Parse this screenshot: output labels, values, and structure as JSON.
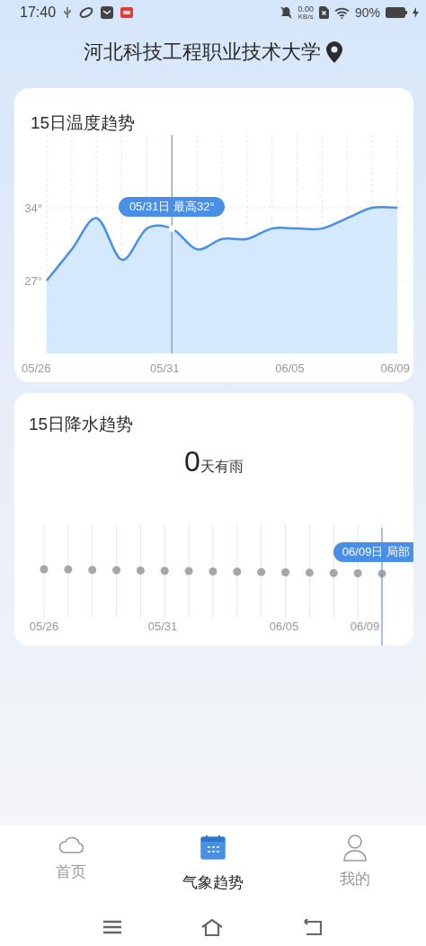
{
  "status_bar": {
    "time": "17:40",
    "net_speed": "0.00",
    "net_unit": "KB/s",
    "battery": "90%"
  },
  "header": {
    "title": "河北科技工程职业技术大学"
  },
  "temperature": {
    "title": "15日温度趋势",
    "chart_data": {
      "type": "area",
      "categories": [
        "05/26",
        null,
        null,
        null,
        null,
        "05/31",
        null,
        null,
        null,
        null,
        "06/05",
        null,
        null,
        null,
        "06/09"
      ],
      "grid": true,
      "series": [
        {
          "color": "#4a90e2",
          "values": [
            27,
            30,
            33,
            29,
            32,
            32,
            30,
            31,
            31,
            32,
            32,
            32,
            33,
            34,
            34
          ]
        }
      ],
      "ylim": [
        20,
        41
      ],
      "yticks": [
        {
          "value": 34,
          "label": "34°"
        },
        {
          "value": 27,
          "label": "27°"
        }
      ],
      "annotations": [
        "05/31日 最高32°"
      ]
    }
  },
  "precipitation": {
    "title": "15日降水趋势",
    "count": "0",
    "count_suffix": "天有雨",
    "tooltip": "06/09日 局部",
    "x_labels": [
      "05/26",
      "05/31",
      "06/05",
      "06/09"
    ]
  },
  "tabs": [
    {
      "label": "首页",
      "selected": false
    },
    {
      "label": "气象趋势",
      "selected": true
    },
    {
      "label": "我的",
      "selected": false
    }
  ]
}
